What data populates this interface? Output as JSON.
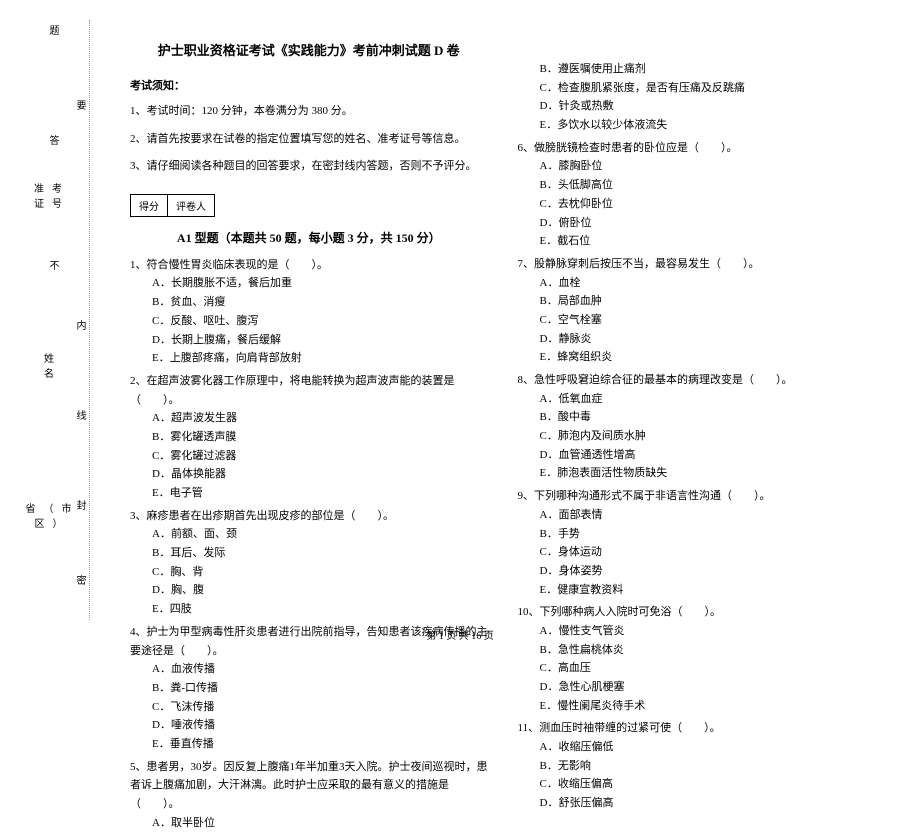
{
  "binding": {
    "outer": [
      "题",
      "答",
      "准考证号",
      "不",
      "姓名",
      "省（市区）"
    ],
    "inner": [
      "要",
      "内",
      "线",
      "封",
      "密"
    ]
  },
  "title": "护士职业资格证考试《实践能力》考前冲刺试题 D 卷",
  "notice_title": "考试须知：",
  "notices": [
    "1、考试时间：120 分钟，本卷满分为 380 分。",
    "2、请首先按要求在试卷的指定位置填写您的姓名、准考证号等信息。",
    "3、请仔细阅读各种题目的回答要求，在密封线内答题，否则不予评分。"
  ],
  "score_labels": {
    "score": "得分",
    "grader": "评卷人"
  },
  "section_title": "A1 型题（本题共 50 题，每小题 3 分，共 150 分）",
  "left_questions": [
    {
      "stem": "1、符合慢性胃炎临床表现的是（　　）。",
      "opts": [
        "A．长期腹胀不适，餐后加重",
        "B．贫血、消瘦",
        "C．反酸、呕吐、腹泻",
        "D．长期上腹痛，餐后缓解",
        "E．上腹部疼痛，向肩背部放射"
      ]
    },
    {
      "stem": "2、在超声波雾化器工作原理中，将电能转换为超声波声能的装置是（　　）。",
      "opts": [
        "A．超声波发生器",
        "B．雾化罐透声膜",
        "C．雾化罐过滤器",
        "D．晶体换能器",
        "E．电子管"
      ]
    },
    {
      "stem": "3、麻疹患者在出疹期首先出现皮疹的部位是（　　）。",
      "opts": [
        "A．前额、面、颈",
        "B．耳后、发际",
        "C．胸、背",
        "D．胸、腹",
        "E．四肢"
      ]
    },
    {
      "stem": "4、护士为甲型病毒性肝炎患者进行出院前指导，告知患者该疾病传播的主要途径是（　　）。",
      "opts": [
        "A．血液传播",
        "B．粪-口传播",
        "C．飞沫传播",
        "D．唾液传播",
        "E．垂直传播"
      ]
    },
    {
      "stem": "5、患者男，30岁。因反复上腹痛1年半加重3天入院。护士夜间巡视时，患者诉上腹痛加剧，大汗淋漓。此时护士应采取的最有意义的措施是（　　）。",
      "opts": [
        "A．取半卧位"
      ]
    }
  ],
  "right_continuation": [
    "B．遵医嘱使用止痛剂",
    "C．检查腹肌紧张度，是否有压痛及反跳痛",
    "D．针灸或热敷",
    "E．多饮水以较少体液流失"
  ],
  "right_questions": [
    {
      "stem": "6、做膀胱镜检查时患者的卧位应是（　　）。",
      "opts": [
        "A．膝胸卧位",
        "B．头低脚高位",
        "C．去枕仰卧位",
        "D．俯卧位",
        "E．截石位"
      ]
    },
    {
      "stem": "7、股静脉穿刺后按压不当，最容易发生（　　）。",
      "opts": [
        "A．血栓",
        "B．局部血肿",
        "C．空气栓塞",
        "D．静脉炎",
        "E．蜂窝组织炎"
      ]
    },
    {
      "stem": "8、急性呼吸窘迫综合征的最基本的病理改变是（　　）。",
      "opts": [
        "A．低氧血症",
        "B．酸中毒",
        "C．肺泡内及间质水肿",
        "D．血管通透性增高",
        "E．肺泡表面活性物质缺失"
      ]
    },
    {
      "stem": "9、下列哪种沟通形式不属于非语言性沟通（　　）。",
      "opts": [
        "A．面部表情",
        "B．手势",
        "C．身体运动",
        "D．身体姿势",
        "E．健康宣教资料"
      ]
    },
    {
      "stem": "10、下列哪种病人入院时可免浴（　　）。",
      "opts": [
        "A．慢性支气管炎",
        "B．急性扁桃体炎",
        "C．高血压",
        "D．急性心肌梗塞",
        "E．慢性阑尾炎待手术"
      ]
    },
    {
      "stem": "11、测血压时袖带缠的过紧可使（　　）。",
      "opts": [
        "A．收缩压偏低",
        "B．无影响",
        "C．收缩压偏高",
        "D．舒张压偏高"
      ]
    }
  ],
  "footer": "第 1 页 共 16 页"
}
